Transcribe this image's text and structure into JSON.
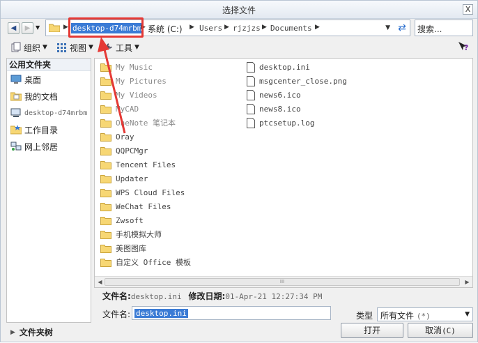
{
  "window": {
    "title": "选择文件",
    "close_label": "X"
  },
  "address": {
    "segments": [
      "desktop-d74mrbm",
      "系统 (C:)",
      "Users",
      "rjzjzs",
      "Documents"
    ],
    "search_placeholder": "搜索..."
  },
  "toolbar": {
    "organize": "组织",
    "view": "视图",
    "tools": "工具"
  },
  "sidebar": {
    "header": "公用文件夹",
    "items": [
      {
        "label": "桌面",
        "icon": "desktop-icon"
      },
      {
        "label": "我的文档",
        "icon": "documents-icon"
      },
      {
        "label": "desktop-d74mrbm",
        "icon": "computer-icon"
      },
      {
        "label": "工作目录",
        "icon": "work-folder-icon"
      },
      {
        "label": "网上邻居",
        "icon": "network-icon"
      }
    ]
  },
  "files": {
    "folders": [
      "My Music",
      "My Pictures",
      "My Videos",
      "MyCAD",
      "OneNote 笔记本",
      "Oray",
      "QQPCMgr",
      "Tencent Files",
      "Updater",
      "WPS Cloud Files",
      "WeChat Files",
      "Zwsoft",
      "手机模拟大师",
      "美图图库",
      "自定义 Office 模板"
    ],
    "documents": [
      "desktop.ini",
      "msgcenter_close.png",
      "news6.ico",
      "news8.ico",
      "ptcsetup.log"
    ],
    "scroll_thumb_label": "III"
  },
  "info": {
    "filename_label": "文件名:",
    "filename_value": "desktop.ini",
    "modified_label": "修改日期:",
    "modified_value": "01-Apr-21 12:27:34 PM"
  },
  "bottom": {
    "filename_label": "文件名:",
    "filename_value": "desktop.ini",
    "type_label": "类型",
    "type_value": "所有文件",
    "type_suffix": "(*)",
    "open_button": "打开",
    "cancel_button": "取消",
    "cancel_hotkey": "(C)",
    "folder_tree": "文件夹树"
  },
  "colors": {
    "accent": "#3a7bd5",
    "annotation": "#e53935"
  }
}
